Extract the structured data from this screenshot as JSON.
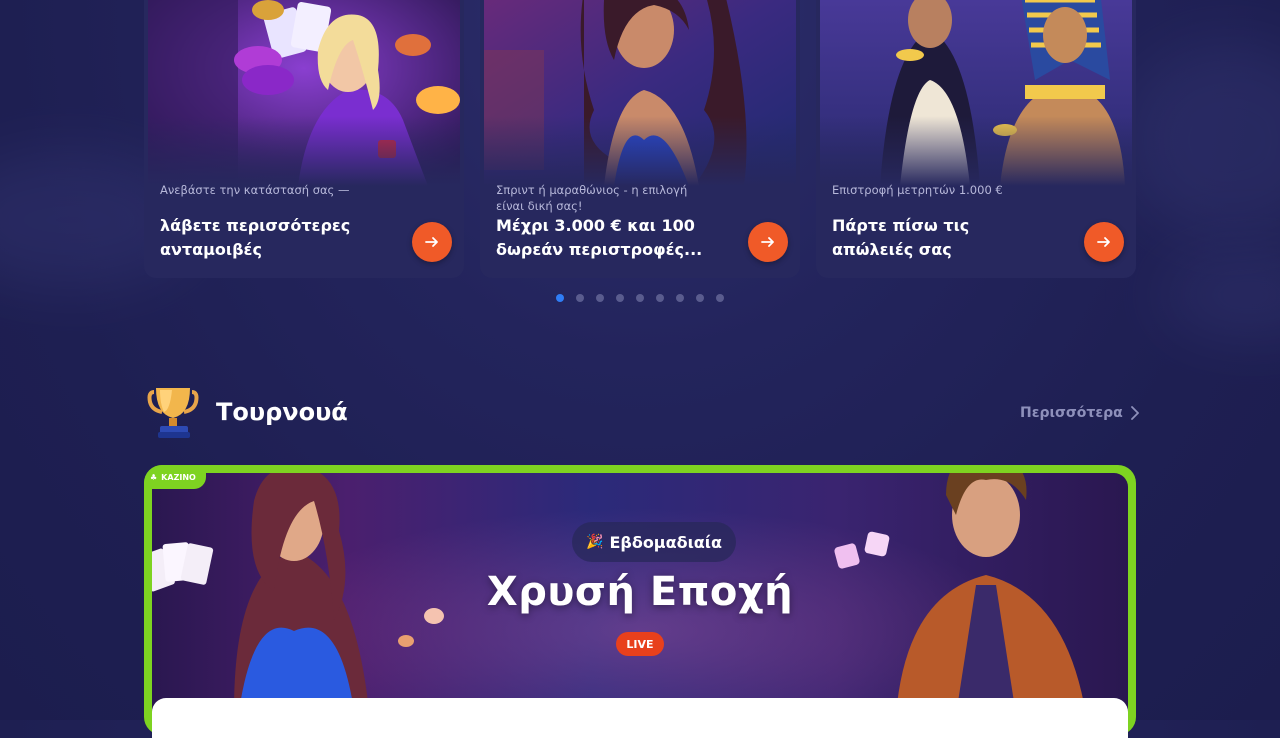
{
  "promos": [
    {
      "subtitle": "Ανεβάστε την κατάστασή σας —",
      "title": "λάβετε περισσότερες ανταμοιβές",
      "art": "casino-girl-chips-art"
    },
    {
      "subtitle": "Σπριντ ή μαραθώνιος - η επιλογή είναι δική σας!",
      "title": "Μέχρι 3.000 € και 100 δωρεάν περιστροφές...",
      "art": "woman-blue-dress-art"
    },
    {
      "subtitle": "Επιστροφή μετρητών 1.000 €",
      "title": "Πάρτε πίσω τις απώλειές σας",
      "art": "egyptian-pharaoh-art"
    }
  ],
  "carousel": {
    "total": 9,
    "active": 1
  },
  "tournaments": {
    "title": "Τουρνουά",
    "more_label": "Περισσότερα",
    "banner": {
      "tag": "KAZINO",
      "pill_label": "Εβδομαδιαία",
      "pill_icon": "party-popper-icon",
      "title": "Χρυσή Εποχή",
      "live_label": "LIVE"
    }
  },
  "colors": {
    "accent": "#f05a28",
    "active_dot": "#2f7df6",
    "banner_border": "#7ed321",
    "live": "#e8401c"
  }
}
